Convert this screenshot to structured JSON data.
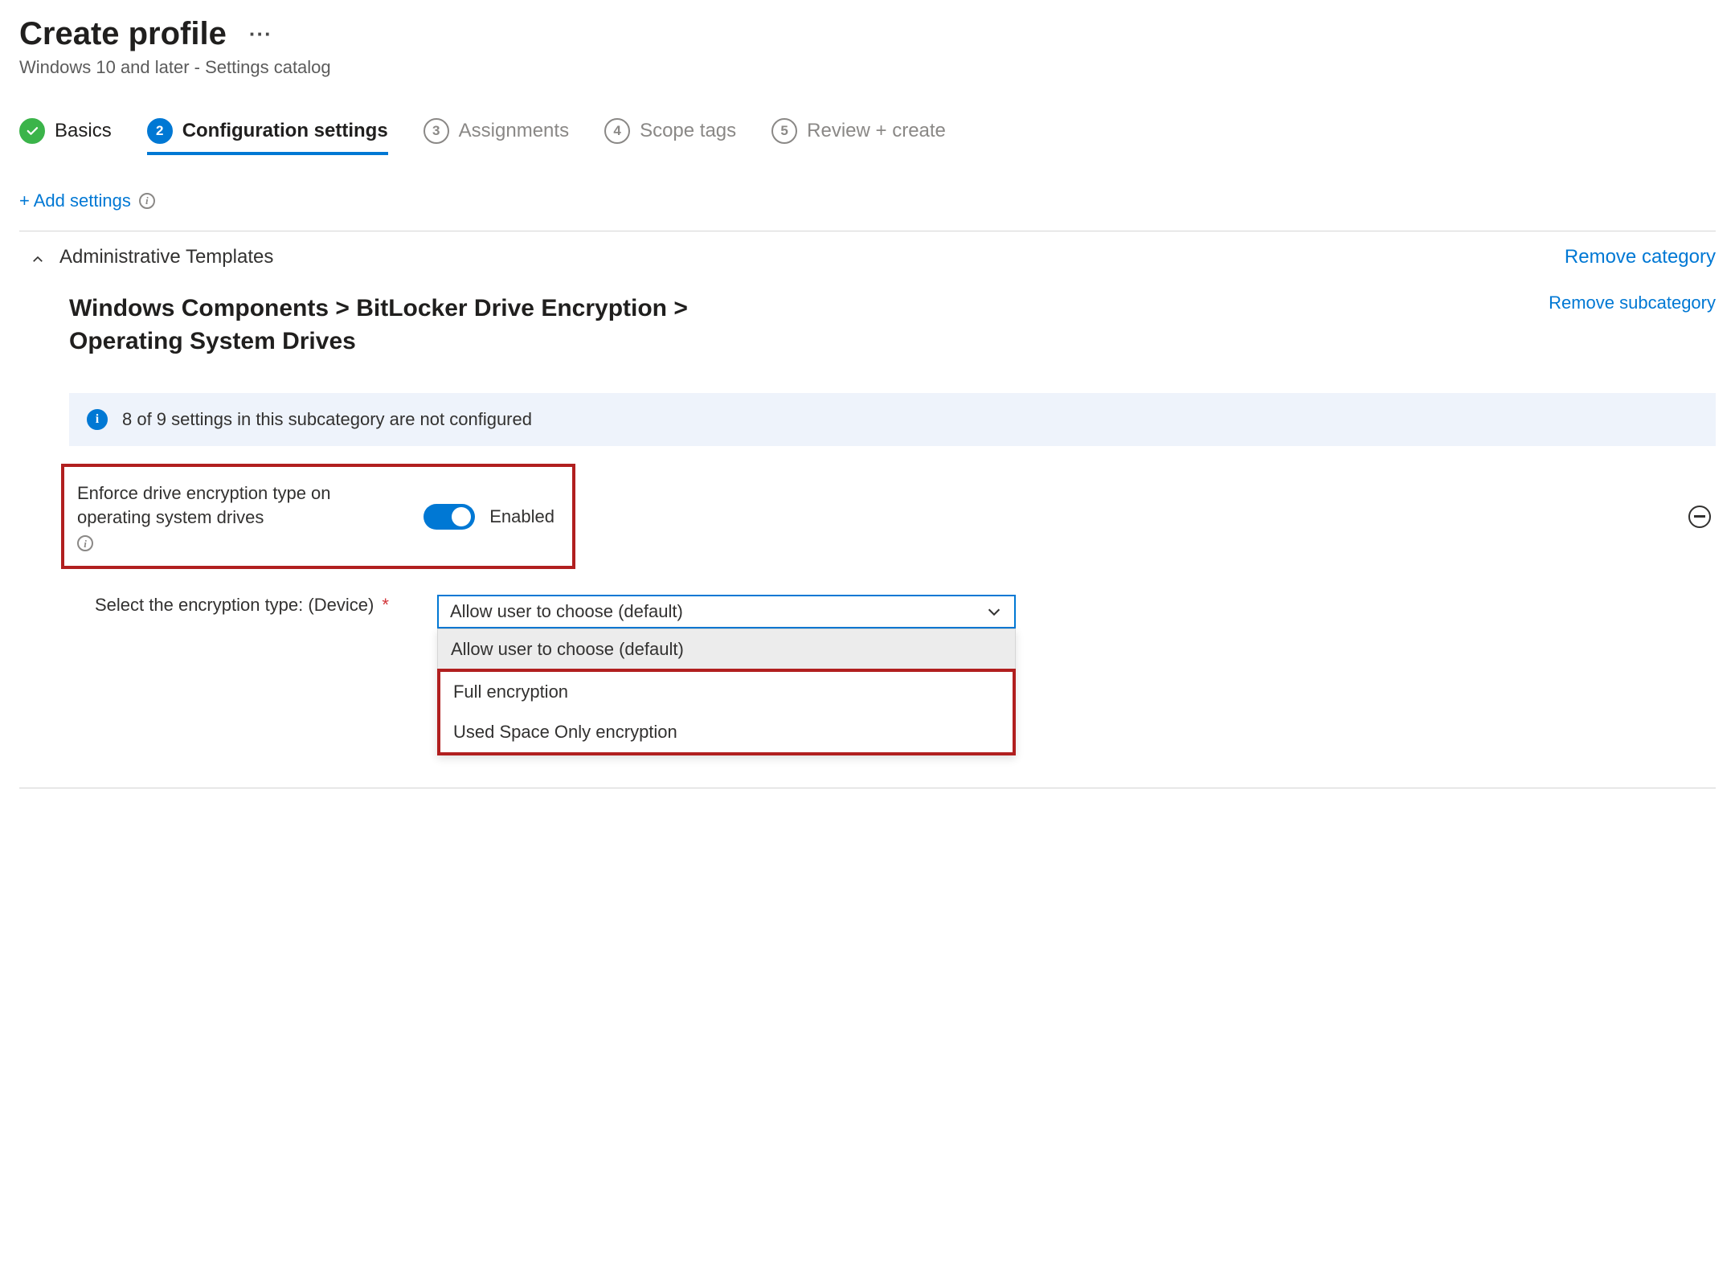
{
  "header": {
    "title": "Create profile",
    "subtitle": "Windows 10 and later - Settings catalog"
  },
  "stepper": {
    "steps": [
      {
        "num": "",
        "label": "Basics"
      },
      {
        "num": "2",
        "label": "Configuration settings"
      },
      {
        "num": "3",
        "label": "Assignments"
      },
      {
        "num": "4",
        "label": "Scope tags"
      },
      {
        "num": "5",
        "label": "Review + create"
      }
    ]
  },
  "actions": {
    "add_settings": "+ Add settings"
  },
  "category": {
    "name": "Administrative Templates",
    "remove": "Remove category"
  },
  "subcategory": {
    "path": "Windows Components > BitLocker Drive Encryption > Operating System Drives",
    "remove": "Remove subcategory"
  },
  "note": "8 of 9 settings in this subcategory are not configured",
  "setting": {
    "label": "Enforce drive encryption type on operating system drives",
    "toggle_state": "Enabled"
  },
  "select": {
    "label": "Select the encryption type: (Device)",
    "value": "Allow user to choose (default)",
    "options": [
      "Allow user to choose (default)",
      "Full encryption",
      "Used Space Only encryption"
    ]
  }
}
